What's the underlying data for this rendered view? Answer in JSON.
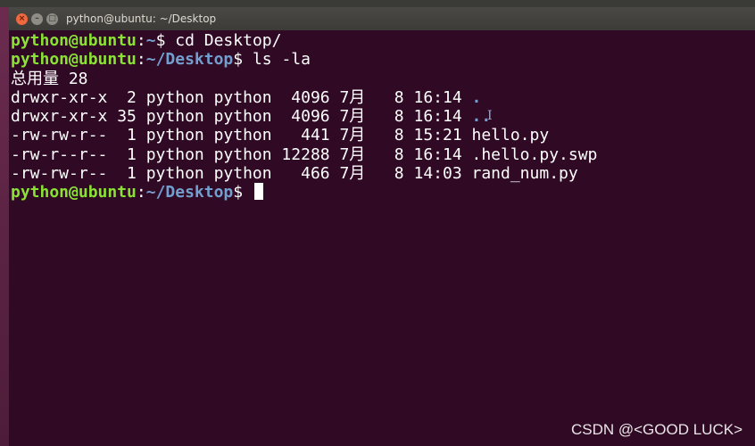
{
  "window": {
    "title": "python@ubuntu: ~/Desktop",
    "close_glyph": "×",
    "minimize_glyph": "–",
    "maximize_glyph": "□"
  },
  "terminal": {
    "line1": {
      "user": "python@ubuntu",
      "sep": ":",
      "path": "~",
      "rest": "$ cd Desktop/"
    },
    "line2": {
      "user": "python@ubuntu",
      "sep": ":",
      "path": "~/Desktop",
      "rest": "$ ls -la"
    },
    "total": "总用量 28",
    "entries": [
      {
        "meta": "drwxr-xr-x  2 python python  4096 7月   8 16:14 ",
        "name": "."
      },
      {
        "meta": "drwxr-xr-x 35 python python  4096 7月   8 16:14 ",
        "name": ".."
      },
      {
        "meta": "-rw-rw-r--  1 python python   441 7月   8 15:21 ",
        "name": "hello.py"
      },
      {
        "meta": "-rw-r--r--  1 python python 12288 7月   8 16:14 ",
        "name": ".hello.py.swp"
      },
      {
        "meta": "-rw-rw-r--  1 python python   466 7月   8 14:03 ",
        "name": "rand_num.py"
      }
    ],
    "line_last": {
      "user": "python@ubuntu",
      "sep": ":",
      "path": "~/Desktop",
      "rest": "$ "
    }
  },
  "watermark": "CSDN @<GOOD LUCK>",
  "colors": {
    "background": "#300a24",
    "prompt_user": "#8ae234",
    "prompt_path": "#729fcf",
    "text": "#ffffff"
  }
}
